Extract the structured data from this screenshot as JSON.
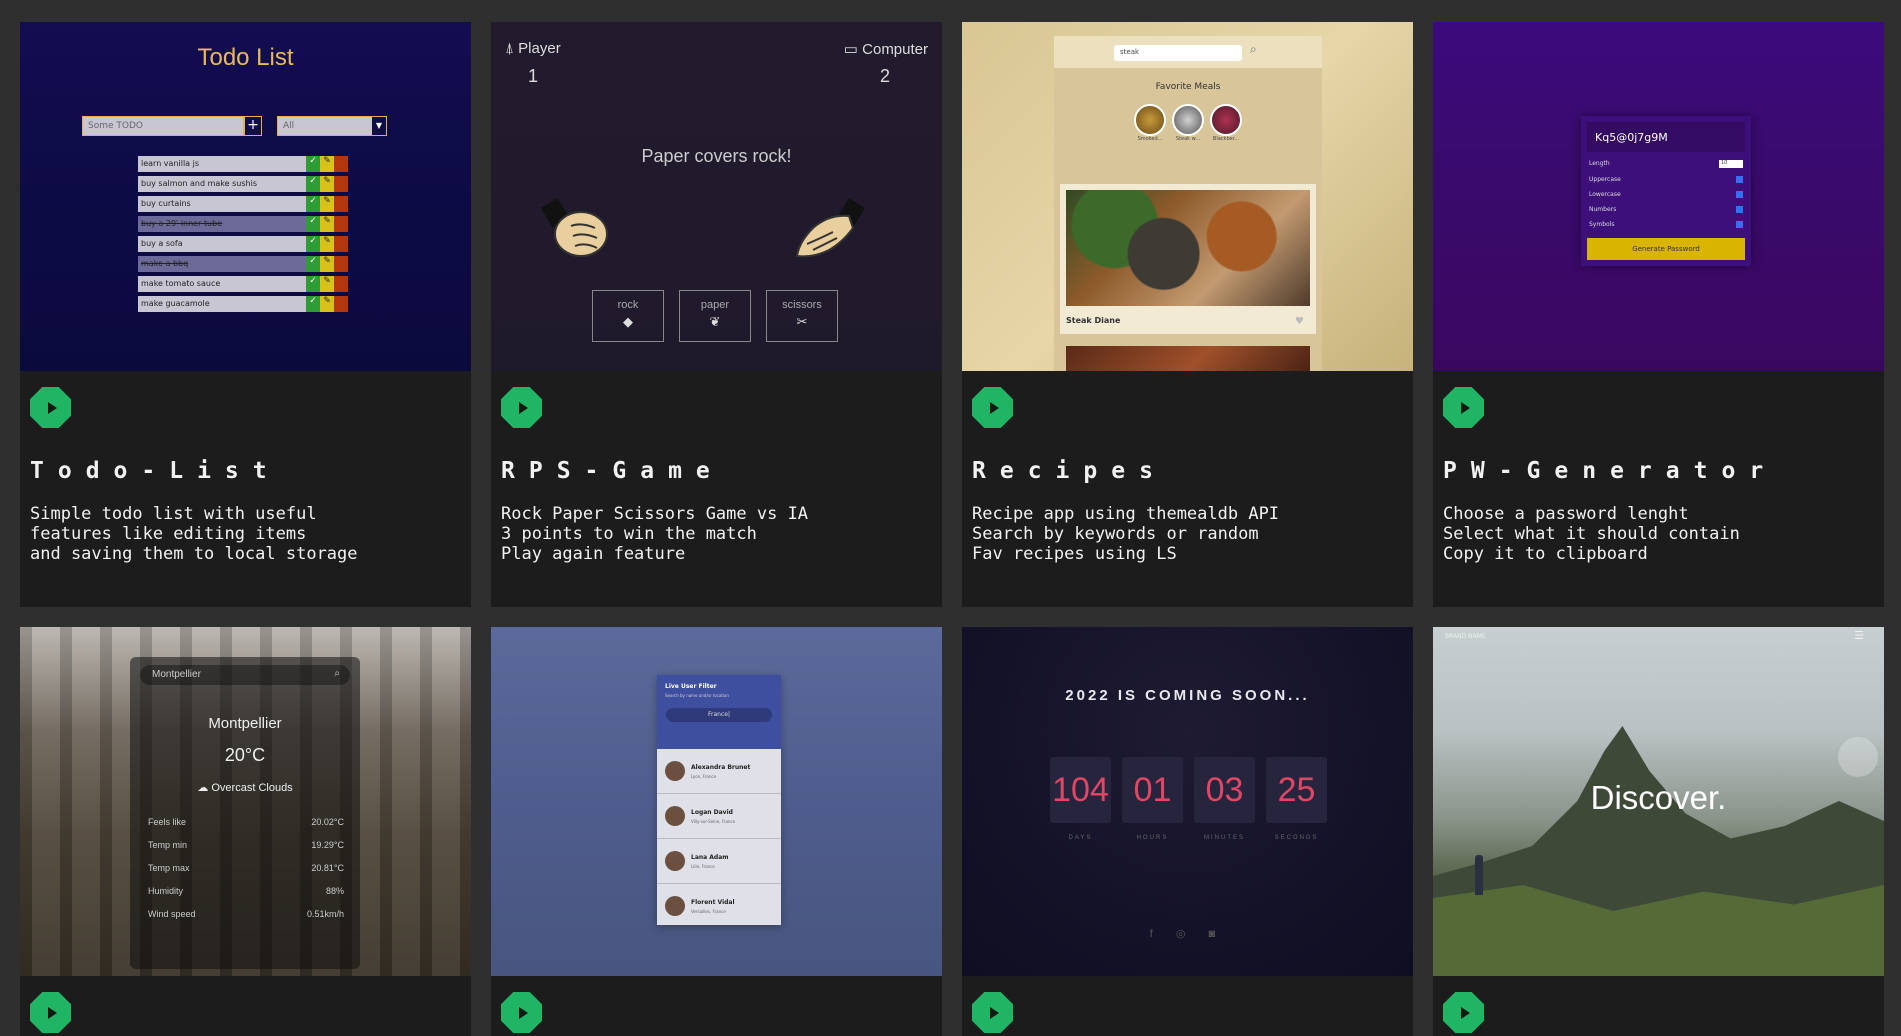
{
  "projects": [
    {
      "title": "Todo-List",
      "description": "Simple todo list with useful\nfeatures like editing items\nand saving them to local storage",
      "preview": {
        "heading": "Todo List",
        "input_placeholder": "Some TODO",
        "filter_value": "All",
        "items": [
          {
            "text": "learn vanilla js",
            "done": false
          },
          {
            "text": "buy salmon and make sushis",
            "done": false
          },
          {
            "text": "buy curtains",
            "done": false
          },
          {
            "text": "buy a 29' inner tube",
            "done": true
          },
          {
            "text": "buy a sofa",
            "done": false
          },
          {
            "text": "make a bbq",
            "done": true
          },
          {
            "text": "make tomato sauce",
            "done": false
          },
          {
            "text": "make guacamole",
            "done": false
          }
        ]
      }
    },
    {
      "title": "RPS-Game",
      "description": "Rock Paper Scissors Game vs IA\n3 points to win the match\nPlay again feature",
      "preview": {
        "player_label": "Player",
        "computer_label": "Computer",
        "player_score": "1",
        "computer_score": "2",
        "result": "Paper covers rock!",
        "buttons": [
          "rock",
          "paper",
          "scissors"
        ]
      }
    },
    {
      "title": "Recipes",
      "description": "Recipe app using themealdb API\nSearch by keywords or random\nFav recipes using LS",
      "preview": {
        "search_value": "steak",
        "favorites_heading": "Favorite Meals",
        "favorites": [
          "Smoked...",
          "Steak w...",
          "Blackber..."
        ],
        "meal_name": "Steak Diane"
      }
    },
    {
      "title": "PW-Generator",
      "description": "Choose a password lenght\nSelect what it should contain\nCopy it to clipboard",
      "preview": {
        "password": "Kq5@0j7g9M",
        "length_label": "Length",
        "length_value": "10",
        "options": [
          "Uppercase",
          "Lowercase",
          "Numbers",
          "Symbols"
        ],
        "generate_label": "Generate Password"
      }
    },
    {
      "preview": {
        "search_value": "Montpellier",
        "city": "Montpellier",
        "temperature": "20°C",
        "description": "Overcast Clouds",
        "stats": [
          {
            "label": "Feels like",
            "value": "20.02°C"
          },
          {
            "label": "Temp min",
            "value": "19.29°C"
          },
          {
            "label": "Temp max",
            "value": "20.81°C"
          },
          {
            "label": "Humidity",
            "value": "88%"
          },
          {
            "label": "Wind speed",
            "value": "0.51km/h"
          }
        ]
      }
    },
    {
      "preview": {
        "heading": "Live User Filter",
        "subheading": "Search by name and/or location",
        "search_value": "France|",
        "users": [
          {
            "name": "Alexandra Brunet",
            "location": "Lyon, France"
          },
          {
            "name": "Logan David",
            "location": "Villy-sur-Seine, France"
          },
          {
            "name": "Lana Adam",
            "location": "Lille, France"
          },
          {
            "name": "Florent Vidal",
            "location": "Versailles, France"
          }
        ]
      }
    },
    {
      "preview": {
        "heading": "2022 IS COMING SOON...",
        "units": [
          {
            "value": "104",
            "label": "DAYS"
          },
          {
            "value": "01",
            "label": "HOURS"
          },
          {
            "value": "03",
            "label": "MINUTES"
          },
          {
            "value": "25",
            "label": "SECONDS"
          }
        ],
        "social": "f ◎ ◙"
      }
    },
    {
      "preview": {
        "brand": "BRAND NAME",
        "menu_icon": "☰",
        "heading": "Discover."
      }
    }
  ],
  "colors": {
    "page_bg": "#2f2f2f",
    "card_bg": "#1c1c1c",
    "play_button": "#1fb564",
    "countdown_digits": "#e14664",
    "todo_heading": "#e8b85a"
  },
  "icons": {
    "play": "play-icon",
    "search": "search-icon",
    "plus": "plus-icon"
  }
}
